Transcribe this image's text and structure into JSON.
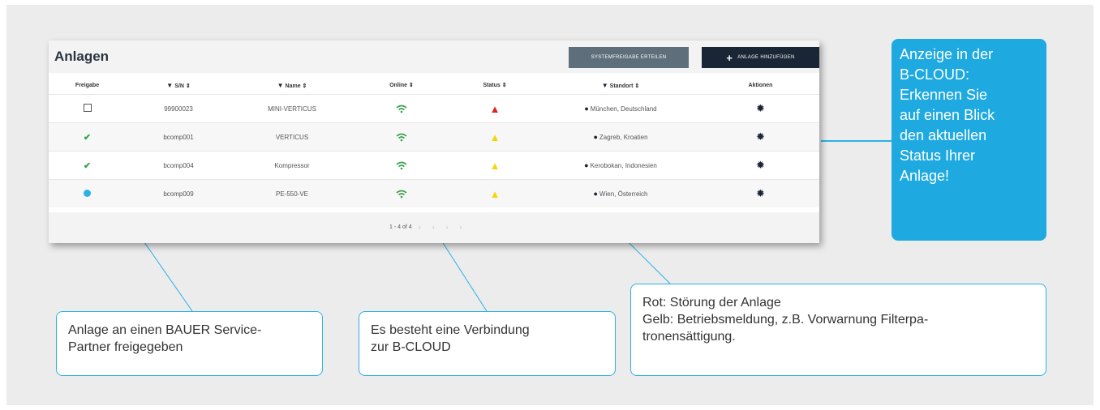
{
  "app": {
    "title": "Anlagen",
    "release_button": "SYSTEMFREIGABE ERTEILEN",
    "add_button": "ANLAGE HINZUFÜGEN",
    "columns": [
      "Freigabe",
      "S/N ⇕",
      "Name ⇕",
      "Online ⇕",
      "Status ⇕",
      "Standort ⇕",
      "Aktionen"
    ],
    "rows": [
      {
        "freigabe": "checkbox",
        "sn": "99900023",
        "name": "MINI-VERTICUS",
        "online": "wifi",
        "status": "red-warning",
        "standort": "München, Deutschland",
        "aktion": "gear-icon"
      },
      {
        "freigabe": "check",
        "sn": "bcomp001",
        "name": "VERTICUS",
        "online": "wifi",
        "status": "yellow-warning",
        "standort": "Zagreb, Kroatien",
        "aktion": "gear-icon"
      },
      {
        "freigabe": "check",
        "sn": "bcomp004",
        "name": "Kompressor",
        "online": "wifi",
        "status": "yellow-warning",
        "standort": "Kerobokan, Indonesien",
        "aktion": "gear-icon"
      },
      {
        "freigabe": "dot",
        "sn": "bcomp009",
        "name": "PE-550-VE",
        "online": "wifi",
        "status": "yellow-warning",
        "standort": "Wien, Österreich",
        "aktion": "gear-icon"
      }
    ],
    "pagination": "1 - 4 of 4",
    "colors": {
      "wifi": "#3aa14a",
      "red": "#e02020",
      "yellow": "#f5d60a",
      "accent": "#29b2e6",
      "dark_button": "#1a2635"
    }
  },
  "callouts": {
    "blue": [
      "Anzeige in der",
      "B-CLOUD:",
      "Erkennen Sie",
      "auf einen Blick",
      "den aktuellen",
      "Status Ihrer",
      "Anlage!"
    ],
    "partner": [
      "Anlage an einen BAUER Service-",
      "Partner freigegeben"
    ],
    "cloud": [
      "Es besteht eine Verbindung",
      "zur B-CLOUD"
    ],
    "status": [
      "Rot: Störung der Anlage",
      "Gelb: Betriebsmeldung, z.B. Vorwarnung Filterpa-",
      "tronensättigung."
    ]
  }
}
